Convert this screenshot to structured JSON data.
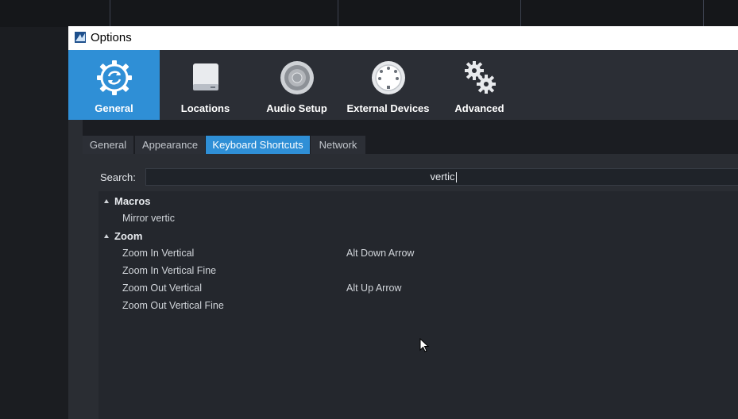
{
  "window": {
    "title": "Options"
  },
  "toolbar": {
    "items": [
      {
        "label": "General",
        "icon": "sync-gear-icon",
        "active": true
      },
      {
        "label": "Locations",
        "icon": "hard-drive-icon"
      },
      {
        "label": "Audio Setup",
        "icon": "speaker-icon"
      },
      {
        "label": "External Devices",
        "icon": "midi-port-icon"
      },
      {
        "label": "Advanced",
        "icon": "gears-icon"
      }
    ]
  },
  "tabs": [
    {
      "label": "General"
    },
    {
      "label": "Appearance"
    },
    {
      "label": "Keyboard Shortcuts",
      "active": true
    },
    {
      "label": "Network"
    }
  ],
  "search": {
    "label": "Search:",
    "value": "vertic"
  },
  "groups": [
    {
      "name": "Macros",
      "items": [
        {
          "name": "Mirror vertic",
          "shortcut": ""
        }
      ]
    },
    {
      "name": "Zoom",
      "items": [
        {
          "name": "Zoom In Vertical",
          "shortcut": "Alt Down Arrow"
        },
        {
          "name": "Zoom In Vertical Fine",
          "shortcut": ""
        },
        {
          "name": "Zoom Out Vertical",
          "shortcut": "Alt Up Arrow"
        },
        {
          "name": "Zoom Out Vertical Fine",
          "shortcut": ""
        }
      ]
    }
  ],
  "colors": {
    "accent": "#2f8fd6",
    "panel": "#2a2d33",
    "list": "#24272d"
  }
}
